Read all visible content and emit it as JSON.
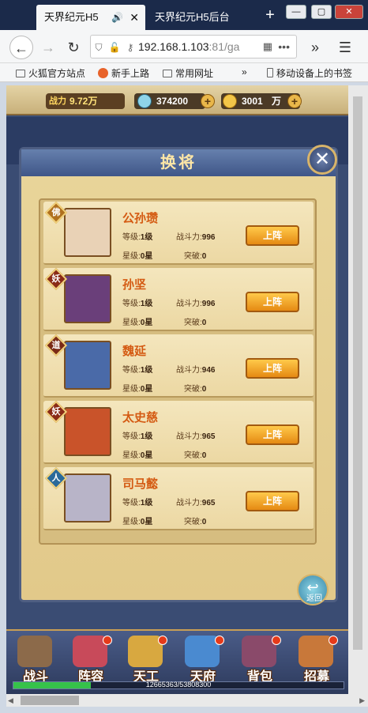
{
  "browser": {
    "tabs": [
      {
        "label": "天界纪元H5",
        "active": true
      },
      {
        "label": "天界纪元H5后台",
        "active": false
      }
    ],
    "new_tab": "+",
    "window_controls": [
      "—",
      "▢",
      "✕"
    ],
    "url": "192.168.1.103",
    "url_port": ":81/ga",
    "bookmarks": [
      "火狐官方站点",
      "新手上路",
      "常用网址",
      "移动设备上的书签"
    ],
    "overflow": "»"
  },
  "resources": {
    "power_label": "战力",
    "power": "9.72万",
    "jade": "374200",
    "gold": "3001",
    "gold_unit": "万",
    "plus": "+"
  },
  "panel": {
    "title": "换将",
    "close": "✕",
    "back_label": "返回"
  },
  "labels": {
    "level": "等级:",
    "combat": "战斗力:",
    "star": "星级:",
    "breakthrough": "突破:",
    "deploy": "上阵"
  },
  "generals": [
    {
      "name": "公孙瓒",
      "badge": "佛",
      "badge_color": "#b0701e",
      "level": "1级",
      "combat": "996",
      "star": "0星",
      "break": "0",
      "portrait_color": "#e9d2b6"
    },
    {
      "name": "孙坚",
      "badge": "妖",
      "badge_color": "#8a2b16",
      "level": "1级",
      "combat": "996",
      "star": "0星",
      "break": "0",
      "portrait_color": "#6a3f7a"
    },
    {
      "name": "魏延",
      "badge": "道",
      "badge_color": "#7a2a16",
      "level": "1级",
      "combat": "946",
      "star": "0星",
      "break": "0",
      "portrait_color": "#4a6aa8"
    },
    {
      "name": "太史慈",
      "badge": "妖",
      "badge_color": "#8a2b16",
      "level": "1级",
      "combat": "965",
      "star": "0星",
      "break": "0",
      "portrait_color": "#c9532a"
    },
    {
      "name": "司马懿",
      "badge": "人",
      "badge_color": "#2a6a9a",
      "level": "1级",
      "combat": "965",
      "star": "0星",
      "break": "0",
      "portrait_color": "#b8b4c8"
    }
  ],
  "nav": [
    {
      "label": "战斗",
      "color": "#8c6a4a",
      "dot": false
    },
    {
      "label": "阵容",
      "color": "#c84a5a",
      "dot": true
    },
    {
      "label": "天工",
      "color": "#d8a840",
      "dot": true
    },
    {
      "label": "天府",
      "color": "#4a8ad0",
      "dot": true
    },
    {
      "label": "背包",
      "color": "#8a4a6a",
      "dot": true
    },
    {
      "label": "招募",
      "color": "#c8783a",
      "dot": true
    }
  ],
  "exp": {
    "text": "12665363/53808300",
    "fraction": 0.235
  }
}
